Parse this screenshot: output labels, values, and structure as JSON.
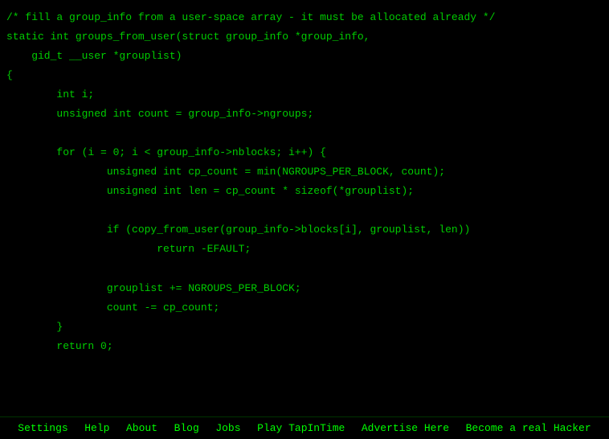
{
  "code": {
    "lines": [
      "/* fill a group_info from a user-space array - it must be allocated already */",
      "static int groups_from_user(struct group_info *group_info,",
      "    gid_t __user *grouplist)",
      "{",
      "        int i;",
      "        unsigned int count = group_info->ngroups;",
      "",
      "        for (i = 0; i < group_info->nblocks; i++) {",
      "                unsigned int cp_count = min(NGROUPS_PER_BLOCK, count);",
      "                unsigned int len = cp_count * sizeof(*grouplist);",
      "",
      "                if (copy_from_user(group_info->blocks[i], grouplist, len))",
      "                        return -EFAULT;",
      "",
      "                grouplist += NGROUPS_PER_BLOCK;",
      "                count -= cp_count;",
      "        }",
      "        return 0;"
    ]
  },
  "footer": {
    "links": [
      "Settings",
      "Help",
      "About",
      "Blog",
      "Jobs",
      "Play TapInTime",
      "Advertise Here",
      "Become a real Hacker"
    ]
  }
}
